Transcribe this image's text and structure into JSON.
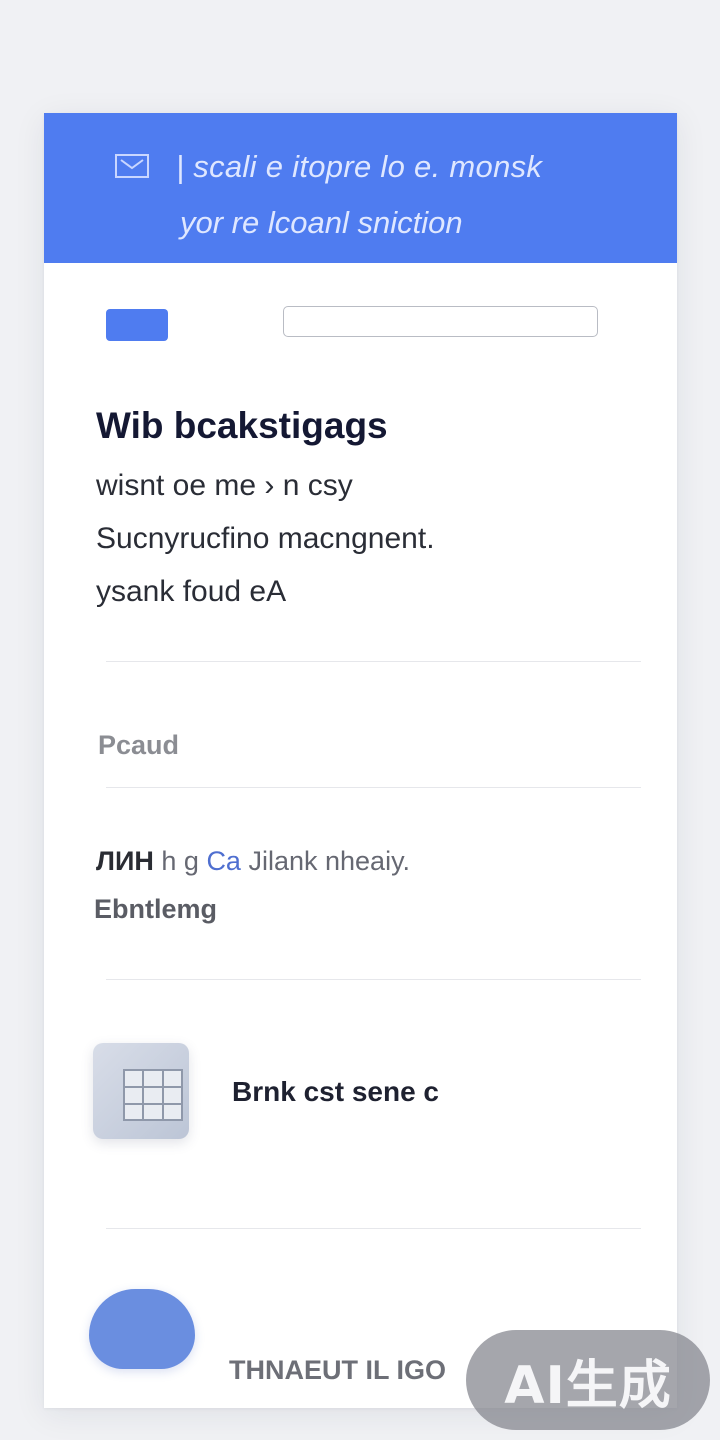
{
  "banner": {
    "line1": "| scali e itopre lo e. monsk",
    "line2": "yor re lcoanl sniction"
  },
  "search": {
    "value": "",
    "placeholder": ""
  },
  "content": {
    "heading": "Wib bcakstigags",
    "lines": [
      "wisnt oe me › n csy",
      "Sucnyrucfino macngnent.",
      "ysank foud eA"
    ]
  },
  "section": {
    "label": "Pcaud"
  },
  "row": {
    "line1_prefix": "ЛИН",
    "line1_mid": "h g",
    "line1_accent": "Ca",
    "line1_rest": "Jilank nheaiy.",
    "line2": "Ebntlemg"
  },
  "item": {
    "caption": "Brnk cst sene c"
  },
  "footer": {
    "label": "THNAEUT IL IGO"
  },
  "watermark": {
    "text": "AI生成"
  },
  "colors": {
    "accent": "#4f7cf0",
    "blob": "#6a8ee0",
    "page_bg": "#f0f1f4"
  }
}
